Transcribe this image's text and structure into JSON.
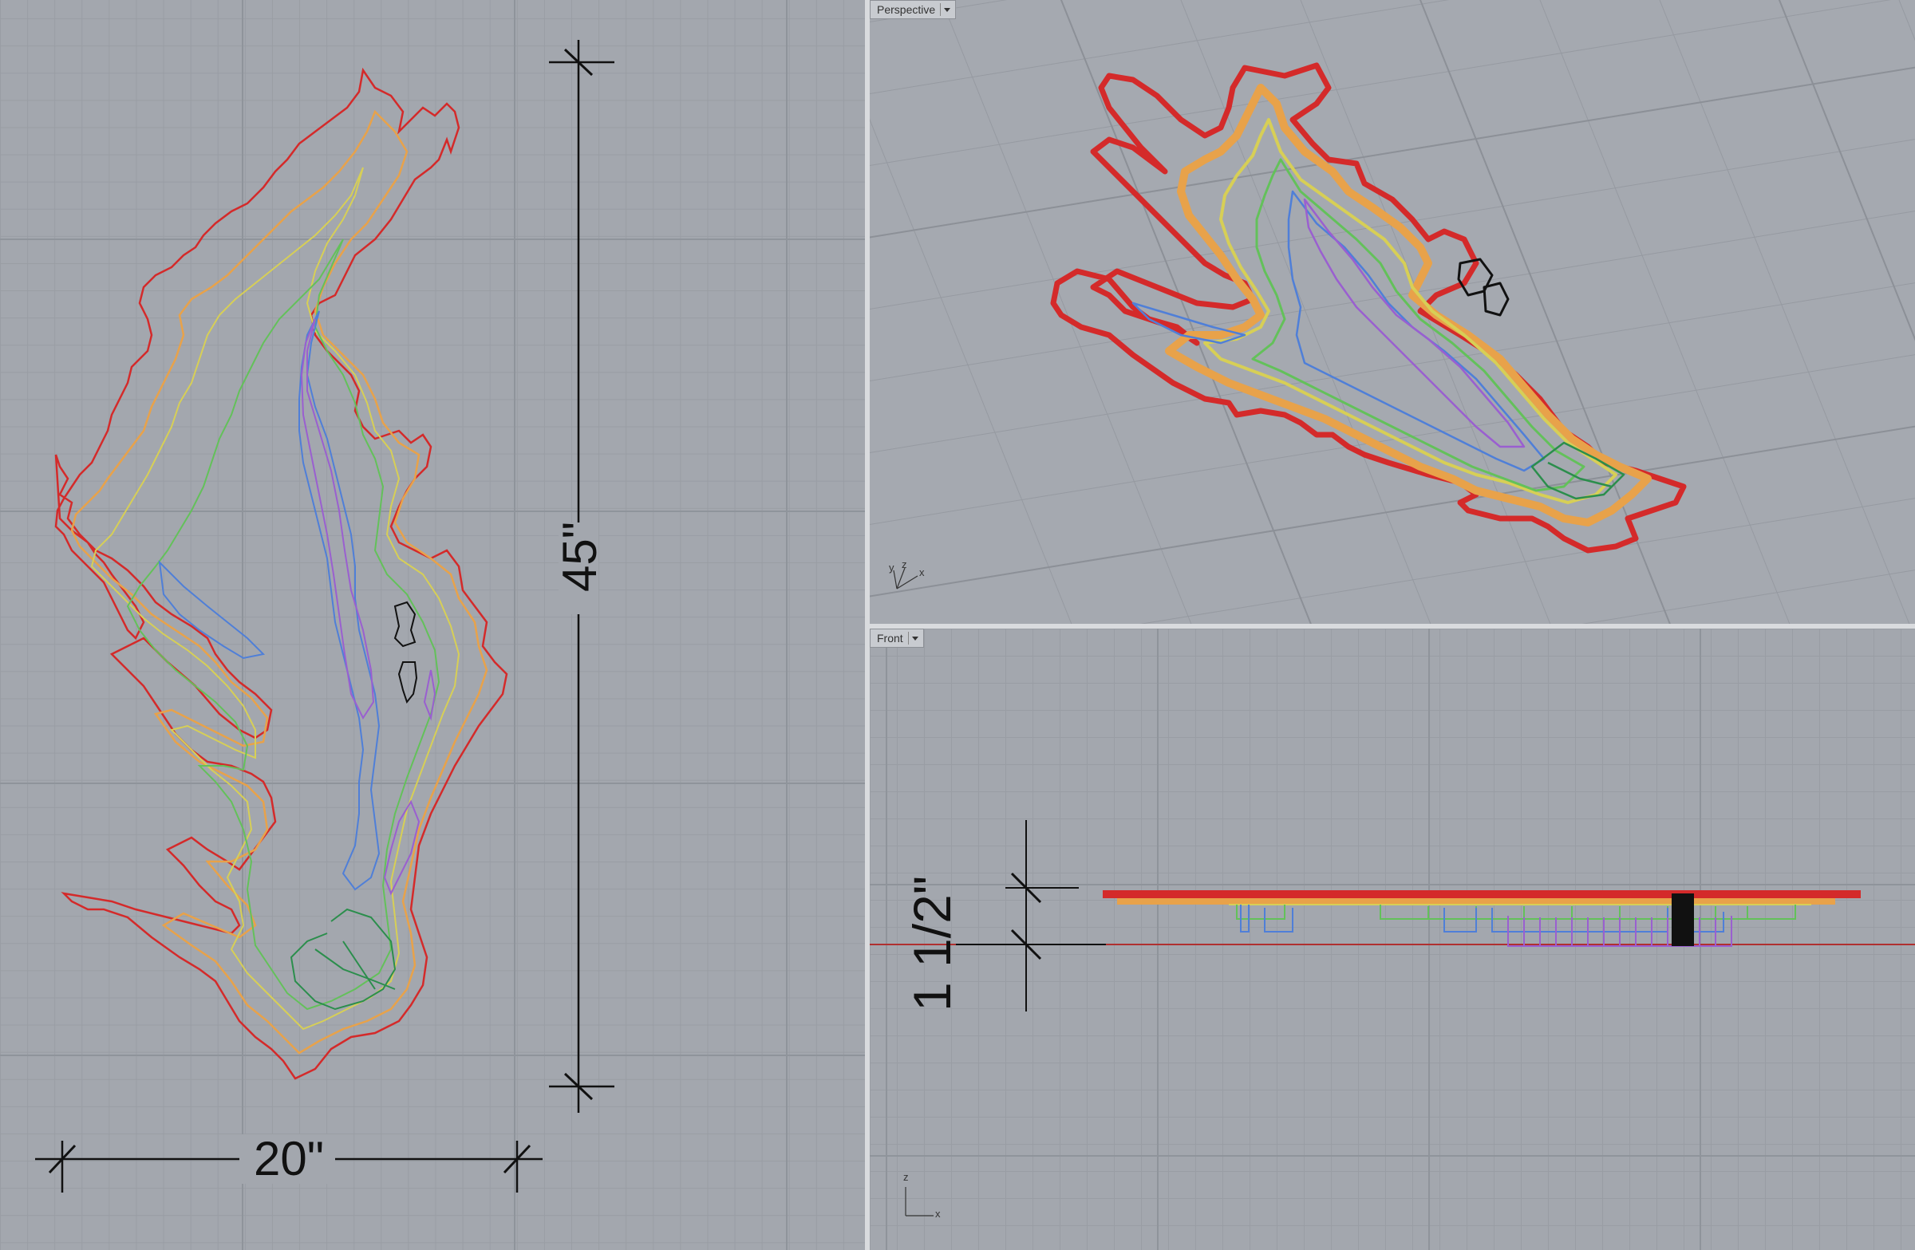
{
  "viewports": {
    "perspective": {
      "label": "Perspective"
    },
    "front": {
      "label": "Front"
    }
  },
  "dimensions": {
    "width": "20\"",
    "height": "45\"",
    "depth": "1 1/2\""
  },
  "axis_labels": {
    "x": "x",
    "y": "y",
    "z": "z"
  },
  "colors": {
    "contour_outer": "#d42a2a",
    "contour_orange": "#e8a24a",
    "contour_yellow": "#d7cf56",
    "contour_green": "#63c15a",
    "contour_dark_green": "#2b8e4c",
    "contour_blue": "#4f7fd8",
    "contour_purple": "#9a5fd0",
    "model_black": "#111111"
  }
}
